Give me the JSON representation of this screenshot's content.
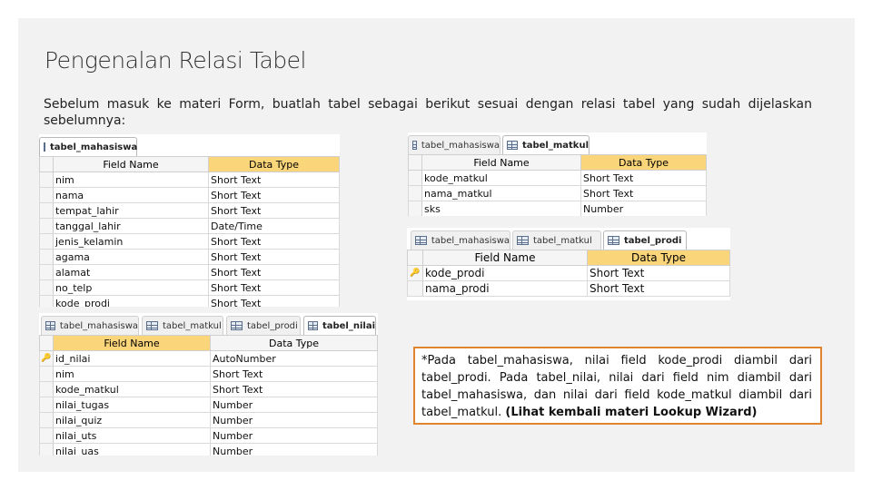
{
  "title": "Pengenalan Relasi Tabel",
  "intro": "Sebelum masuk ke materi Form, buatlah tabel sebagai berikut sesuai dengan relasi tabel yang sudah dijelaskan sebelumnya:",
  "headers": {
    "field_name": "Field Name",
    "data_type": "Data Type"
  },
  "key_icon": "primary-key-icon",
  "tbl1": {
    "tabs": [
      "tabel_mahasiswa"
    ],
    "rows": [
      [
        "nim",
        "Short Text"
      ],
      [
        "nama",
        "Short Text"
      ],
      [
        "tempat_lahir",
        "Short Text"
      ],
      [
        "tanggal_lahir",
        "Date/Time"
      ],
      [
        "jenis_kelamin",
        "Short Text"
      ],
      [
        "agama",
        "Short Text"
      ],
      [
        "alamat",
        "Short Text"
      ],
      [
        "no_telp",
        "Short Text"
      ],
      [
        "kode_prodi",
        "Short Text"
      ]
    ]
  },
  "tbl2": {
    "tabs": [
      "tabel_mahasiswa",
      "tabel_matkul"
    ],
    "rows": [
      [
        "kode_matkul",
        "Short Text"
      ],
      [
        "nama_matkul",
        "Short Text"
      ],
      [
        "sks",
        "Number"
      ]
    ]
  },
  "tbl3": {
    "tabs": [
      "tabel_mahasiswa",
      "tabel_matkul",
      "tabel_prodi"
    ],
    "rows": [
      [
        "kode_prodi",
        "Short Text"
      ],
      [
        "nama_prodi",
        "Short Text"
      ]
    ]
  },
  "tbl4": {
    "tabs": [
      "tabel_mahasiswa",
      "tabel_matkul",
      "tabel_prodi",
      "tabel_nilai"
    ],
    "rows": [
      [
        "id_nilai",
        "AutoNumber"
      ],
      [
        "nim",
        "Short Text"
      ],
      [
        "kode_matkul",
        "Short Text"
      ],
      [
        "nilai_tugas",
        "Number"
      ],
      [
        "nilai_quiz",
        "Number"
      ],
      [
        "nilai_uts",
        "Number"
      ],
      [
        "nilai_uas",
        "Number"
      ]
    ]
  },
  "note": {
    "text": "*Pada tabel_mahasiswa, nilai field kode_prodi diambil dari tabel_prodi. Pada tabel_nilai, nilai dari field nim diambil dari tabel_mahasiswa, dan nilai dari field kode_matkul diambil dari tabel_matkul. ",
    "bold": "(Lihat kembali materi Lookup Wizard)"
  }
}
